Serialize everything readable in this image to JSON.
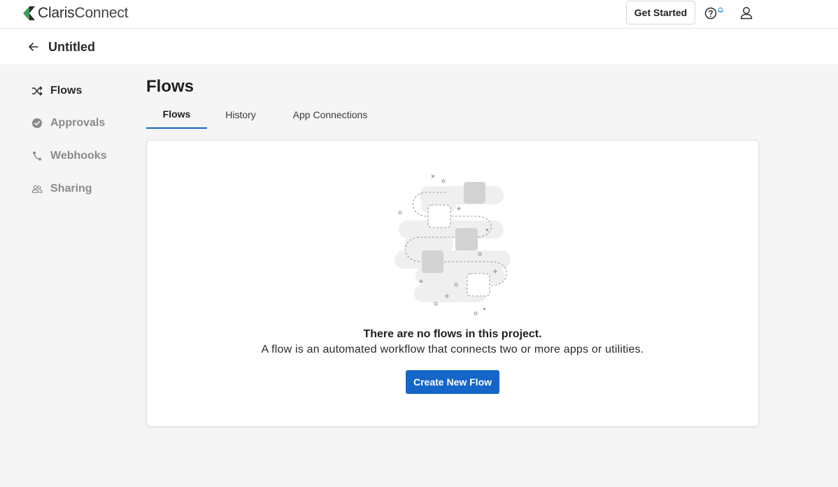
{
  "app": {
    "logo_text_bold": "Claris",
    "logo_text_light": "Connect",
    "logo_icon": "claris-logo-icon"
  },
  "topbar": {
    "get_started_label": "Get Started",
    "help_icon": "help-icon",
    "notification_icon": "bell-icon",
    "user_icon": "user-icon"
  },
  "project": {
    "title": "Untitled",
    "back_icon": "arrow-left-icon"
  },
  "sidebar": {
    "items": [
      {
        "label": "Flows",
        "icon": "shuffle-icon",
        "active": true
      },
      {
        "label": "Approvals",
        "icon": "check-circle-icon",
        "active": false
      },
      {
        "label": "Webhooks",
        "icon": "webhook-icon",
        "active": false
      },
      {
        "label": "Sharing",
        "icon": "people-icon",
        "active": false
      }
    ]
  },
  "main": {
    "title": "Flows",
    "tabs": [
      {
        "label": "Flows",
        "active": true
      },
      {
        "label": "History",
        "active": false
      },
      {
        "label": "App Connections",
        "active": false
      }
    ],
    "empty_state": {
      "title": "There are no flows in this project.",
      "description": "A flow is an automated workflow that connects two or more apps or utilities.",
      "button_label": "Create New Flow",
      "illustration": "empty-flows-illustration"
    }
  },
  "colors": {
    "accent": "#1566c8",
    "background": "#f5f5f5",
    "surface": "#ffffff",
    "muted_text": "#8a8a8a",
    "notification_dot": "#3b8de0"
  }
}
